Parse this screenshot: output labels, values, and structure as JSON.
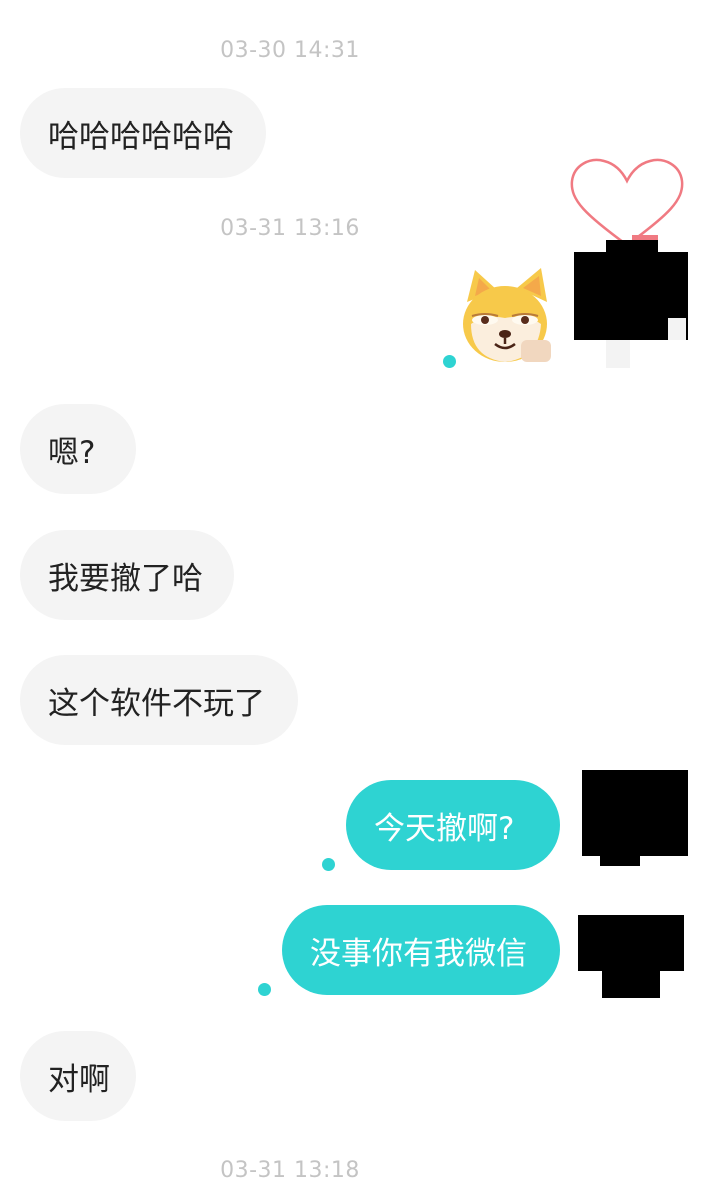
{
  "colors": {
    "incoming_bubble": "#f4f4f4",
    "outgoing_bubble": "#2ed3d2",
    "timestamp_text": "#c4c4c4",
    "unread_dot": "#2ed3d2"
  },
  "timestamps": {
    "t1": "03-30 14:31",
    "t2": "03-31 13:16",
    "t3": "03-31 13:18"
  },
  "messages": {
    "m1": "哈哈哈哈哈哈",
    "m3": "嗯?",
    "m4": "我要撤了哈",
    "m5": "这个软件不玩了",
    "m6": "今天撤啊?",
    "m7": "没事你有我微信",
    "m8": "对啊"
  },
  "sticker": {
    "icon": "shiba-dog-sticker-icon"
  },
  "avatar_frame": {
    "icon": "heart-outline-icon"
  }
}
